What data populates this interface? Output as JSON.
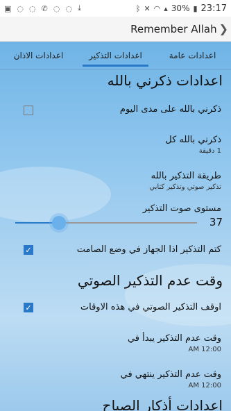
{
  "status_bar": {
    "time": "23:17",
    "battery": "30%",
    "left_icons": [
      "image-icon",
      "chat-icon",
      "chat-icon",
      "viber-icon",
      "chat-icon",
      "chat-icon",
      "download-icon"
    ],
    "right_icons": [
      "bluetooth-icon",
      "mute-icon",
      "wifi-icon",
      "signal-icon"
    ]
  },
  "app_bar": {
    "title": "Remember Allah",
    "back_icon": "chevron-icon"
  },
  "tabs": [
    {
      "label": "اعدادات الاذان"
    },
    {
      "label": "اعدادات التذكير",
      "active": true
    },
    {
      "label": "اعدادات عامة"
    }
  ],
  "section1": {
    "title": "اعدادات ذكرني بالله"
  },
  "pref_remind_all_day": {
    "title": "ذكرني بالله على مدى اليوم",
    "checked": false
  },
  "pref_remind_every": {
    "title": "ذكرني بالله كل",
    "summary": "1 دقيقة"
  },
  "pref_method": {
    "title": "طريقة التذكير بالله",
    "summary": "تذكير صوتي وتذكير كتابي"
  },
  "pref_volume": {
    "title": "مستوى صوت التذكير",
    "value": "37",
    "level_percent": 37
  },
  "pref_mute_silent": {
    "title": "كتم التذكير اذا الجهاز في وضع الصامت",
    "checked": true
  },
  "section2": {
    "title": "وقت عدم التذكير الصوتي"
  },
  "pref_stop_voice": {
    "title": "اوقف التذكير الصوتي في هذه الاوقات",
    "checked": true
  },
  "pref_start_time": {
    "title": "وقت عدم التذكير يبدأ في",
    "summary": "12:00 AM"
  },
  "pref_end_time": {
    "title": "وقت عدم التذكير ينتهي في",
    "summary": "12:00 AM"
  },
  "section3": {
    "title": "اعدادات أذكار الصباح"
  },
  "colors": {
    "accent": "#2a78c8",
    "sky": "#8fc6ee"
  }
}
